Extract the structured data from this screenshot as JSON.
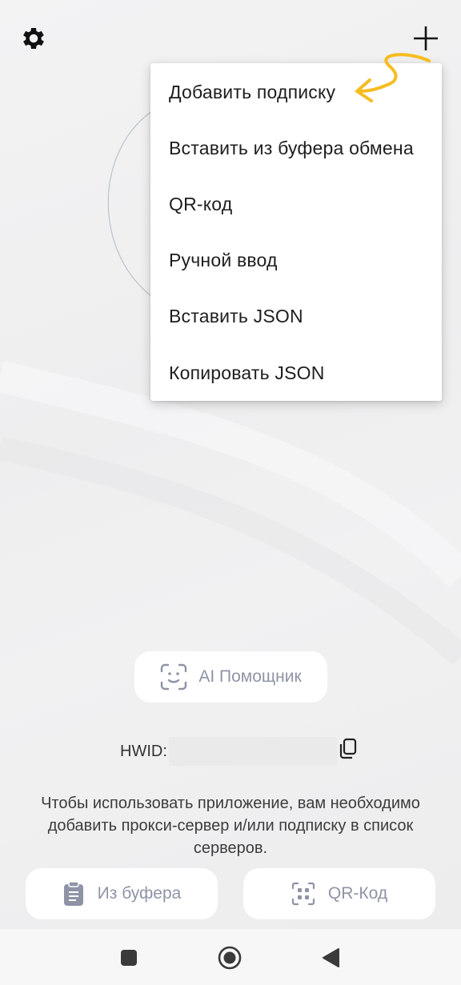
{
  "menu": {
    "items": [
      "Добавить подписку",
      "Вставить из буфера обмена",
      "QR-код",
      "Ручной ввод",
      "Вставить JSON",
      "Копировать JSON"
    ]
  },
  "ai_assistant": {
    "label": "AI Помощник"
  },
  "hwid": {
    "label": "HWID:"
  },
  "hint": {
    "text": "Чтобы использовать приложение, вам необходимо добавить прокси-сервер и/или подписку в список серверов."
  },
  "actions": {
    "clipboard_label": "Из буфера",
    "qr_label": "QR-Код"
  },
  "colors": {
    "accent_arrow": "#f6bc21",
    "icon_muted": "#8f93a6"
  },
  "icons": {
    "settings": "gear-icon",
    "add": "plus-icon",
    "ai": "face-scan-icon",
    "copy": "copy-icon",
    "clipboard": "clipboard-icon",
    "qr": "qr-icon",
    "nav_recent": "square-icon",
    "nav_home": "circle-icon",
    "nav_back": "triangle-back-icon"
  }
}
